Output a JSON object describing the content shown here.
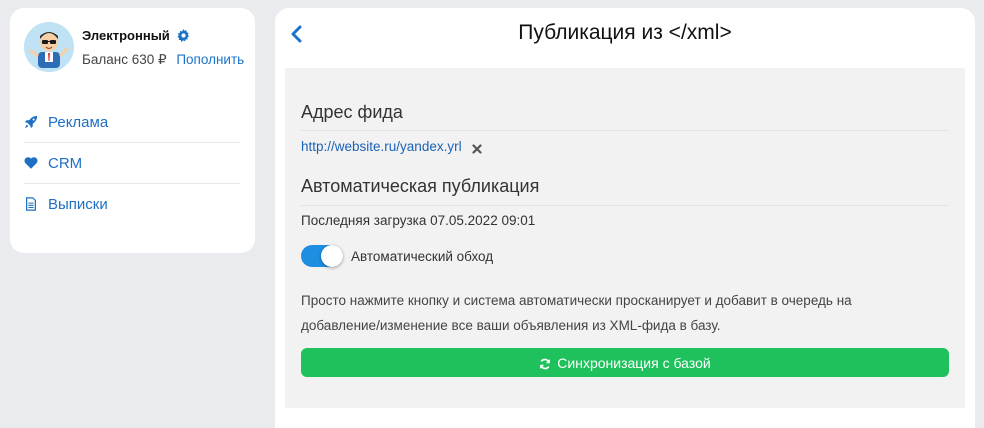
{
  "profile": {
    "name": "Электронный",
    "balance": "Баланс 630 ₽",
    "topup_label": "Пополнить",
    "avatar_icon": "cartoon-person-avatar",
    "settings_icon": "gear-icon"
  },
  "sidebar": {
    "items": [
      {
        "label": "Реклама",
        "icon": "rocket-icon"
      },
      {
        "label": "CRM",
        "icon": "heart-icon"
      },
      {
        "label": "Выписки",
        "icon": "document-icon"
      }
    ]
  },
  "header": {
    "title": "Публикация из </xml>",
    "back_icon": "chevron-left-icon"
  },
  "feed": {
    "section_title": "Адрес фида",
    "url": "http://website.ru/yandex.yrl",
    "remove_icon": "close-icon"
  },
  "auto": {
    "section_title": "Автоматическая публикация",
    "last_load": "Последняя загрузка 07.05.2022 09:01",
    "toggle_label": "Автоматический обход",
    "toggle_on": true,
    "description": "Просто нажмите кнопку и система автоматически просканирует и добавит в очередь на добавление/изменение все ваши объявления из XML-фида в базу.",
    "sync_label": "Синхронизация с базой",
    "sync_icon": "refresh-icon"
  },
  "colors": {
    "accent": "#1a73c9",
    "toggle": "#1e8ee0",
    "sync_button": "#1ec15b",
    "background": "#e9ebee"
  }
}
